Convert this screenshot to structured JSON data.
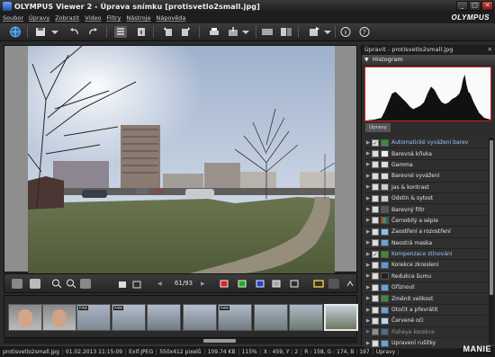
{
  "window": {
    "app_name": "OLYMPUS Viewer 2 -",
    "doc_title": "Úprava snímku [protisvetlo2small.jpg]"
  },
  "menu": {
    "items": [
      "Soubor",
      "Úpravy",
      "Zobrazit",
      "Video",
      "Filtry",
      "Nástroje",
      "Nápověda"
    ],
    "brand": "OLYMPUS"
  },
  "viewer": {
    "page": "61/93"
  },
  "filmstrip": {
    "raw_badge": "RAW"
  },
  "status": {
    "filename": "protisvetlo2small.jpg",
    "datetime": "01.02.2013 11:15:09",
    "format": "Exif-JPEG",
    "size": "550x412 pixelů",
    "filesize": "109.74 KB",
    "zoom": "115%",
    "coords": "X : 459, Y : 2",
    "rgb": "R : 158, G : 174, B : 197",
    "state": "Úpravy"
  },
  "panel": {
    "header": "Úpravit - protisvetlo2small.jpg",
    "histogram_label": "Histogram",
    "tab_label": "Úpravy",
    "items": [
      "Automatické vyvážení barev",
      "Barevná křivka",
      "Gamma",
      "Barevné vyvážení",
      "Jas & kontrast",
      "Odstín & sytost",
      "Barevný filtr",
      "Černobílý a sépie",
      "Zaostření a rozostření",
      "Neostrá maska",
      "Kompenzace stínování",
      "Korekce zkreslení",
      "Redukce šumu",
      "Oříznout",
      "Změnit velikost",
      "Otočit a převrátit",
      "Červené oči",
      "Fisheye korekce",
      "Upravení rušitky"
    ]
  },
  "watermark": "MANIE"
}
